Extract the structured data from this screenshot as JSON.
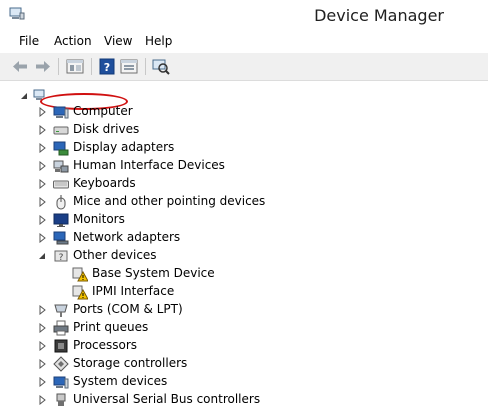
{
  "window": {
    "title": "Device Manager",
    "app_icon": "device-manager-icon"
  },
  "menu": [
    "File",
    "Action",
    "View",
    "Help"
  ],
  "toolbar": {
    "buttons": [
      "back-arrow-icon",
      "forward-arrow-icon",
      "properties-icon",
      "help-icon",
      "show-hide-tree-icon",
      "scan-hardware-icon"
    ]
  },
  "tree": {
    "root": {
      "expanded": true,
      "label_redacted": true
    },
    "categories": [
      {
        "label": "Computer",
        "icon": "computer-icon",
        "expanded": false
      },
      {
        "label": "Disk drives",
        "icon": "disk-drive-icon",
        "expanded": false
      },
      {
        "label": "Display adapters",
        "icon": "display-adapter-icon",
        "expanded": false
      },
      {
        "label": "Human Interface Devices",
        "icon": "hid-icon",
        "expanded": false
      },
      {
        "label": "Keyboards",
        "icon": "keyboard-icon",
        "expanded": false
      },
      {
        "label": "Mice and other pointing devices",
        "icon": "mouse-icon",
        "expanded": false
      },
      {
        "label": "Monitors",
        "icon": "monitor-icon",
        "expanded": false
      },
      {
        "label": "Network adapters",
        "icon": "network-adapter-icon",
        "expanded": false
      },
      {
        "label": "Other devices",
        "icon": "other-devices-icon",
        "expanded": true,
        "children": [
          {
            "label": "Base System Device",
            "icon": "warning-device-icon"
          },
          {
            "label": "IPMI Interface",
            "icon": "warning-device-icon"
          }
        ]
      },
      {
        "label": "Ports (COM & LPT)",
        "icon": "port-icon",
        "expanded": false
      },
      {
        "label": "Print queues",
        "icon": "printer-icon",
        "expanded": false
      },
      {
        "label": "Processors",
        "icon": "processor-icon",
        "expanded": false
      },
      {
        "label": "Storage controllers",
        "icon": "storage-controller-icon",
        "expanded": false
      },
      {
        "label": "System devices",
        "icon": "system-devices-icon",
        "expanded": false
      },
      {
        "label": "Universal Serial Bus controllers",
        "icon": "usb-icon",
        "expanded": false
      }
    ]
  }
}
